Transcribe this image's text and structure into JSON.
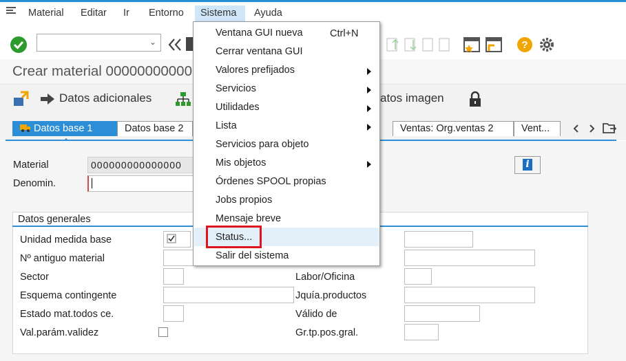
{
  "menubar": {
    "items": [
      "Material",
      "Editar",
      "Ir",
      "Entorno",
      "Sistema",
      "Ayuda"
    ],
    "active": "Sistema"
  },
  "window": {
    "title": "Crear material 00000000000"
  },
  "appbar": {
    "additional_data_label": "Datos adicionales",
    "image_data_label": "atos imagen"
  },
  "tabs": [
    "Datos base 1",
    "Datos base 2",
    "Ventas: Org.ventas 2",
    "Vent..."
  ],
  "header_fields": {
    "material_label": "Material",
    "material_value": "000000000000000",
    "description_label": "Denomin.",
    "description_value": ""
  },
  "group": {
    "title": "Datos generales",
    "left_fields": [
      {
        "label": "Unidad medida base",
        "value": ""
      },
      {
        "label": "Nº antiguo material",
        "value": ""
      },
      {
        "label": "Sector",
        "value": ""
      },
      {
        "label": "Esquema contingente",
        "value": ""
      },
      {
        "label": "Estado mat.todos ce.",
        "value": ""
      },
      {
        "label": "Val.parám.validez",
        "value": ""
      }
    ],
    "right_fields": [
      {
        "label": "",
        "value": ""
      },
      {
        "label": "",
        "value": ""
      },
      {
        "label": "Labor/Oficina",
        "value": ""
      },
      {
        "label": "Jquía.productos",
        "value": ""
      },
      {
        "label": "Válido de",
        "value": ""
      },
      {
        "label": "Gr.tp.pos.gral.",
        "value": ""
      }
    ]
  },
  "dropdown": {
    "items": [
      {
        "label": "Ventana GUI nueva",
        "shortcut": "Ctrl+N"
      },
      {
        "label": "Cerrar ventana GUI"
      },
      {
        "label": "Valores prefijados"
      },
      {
        "label": "Servicios"
      },
      {
        "label": "Utilidades"
      },
      {
        "label": "Lista"
      },
      {
        "label": "Servicios para objeto"
      },
      {
        "label": "Mis objetos"
      },
      {
        "label": "Órdenes SPOOL propias"
      },
      {
        "label": "Jobs propios"
      },
      {
        "label": "Mensaje breve"
      },
      {
        "label": "Status..."
      },
      {
        "label": "Salir del sistema"
      }
    ],
    "highlighted": "Status..."
  },
  "colors": {
    "accent": "#2b8ed6",
    "highlight_box": "#e0141e",
    "ok_green": "#2c9a2c",
    "help_orange": "#f0a500"
  }
}
